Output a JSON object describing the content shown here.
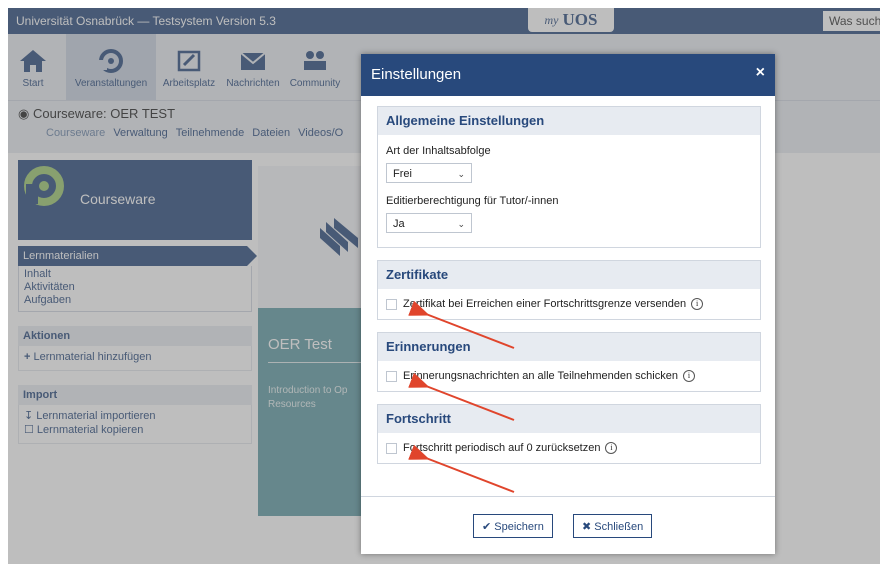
{
  "header": {
    "app_title": "Universität Osnabrück — Testsystem Version 5.3",
    "logo_prefix": "my",
    "logo_text": "UOS",
    "search_placeholder": "Was suche"
  },
  "nav": [
    {
      "label": "Start"
    },
    {
      "label": "Veranstaltungen"
    },
    {
      "label": "Arbeitsplatz"
    },
    {
      "label": "Nachrichten"
    },
    {
      "label": "Community"
    }
  ],
  "course": {
    "title": "Courseware: OER TEST",
    "tabs": [
      "Courseware",
      "Verwaltung",
      "Teilnehmende",
      "Dateien",
      "Videos/O"
    ]
  },
  "sidebar": {
    "courseware_label": "Courseware",
    "active_item": "Lernmaterialien",
    "items": [
      "Inhalt",
      "Aktivitäten",
      "Aufgaben"
    ],
    "actions_title": "Aktionen",
    "actions": [
      "Lernmaterial hinzufügen"
    ],
    "import_title": "Import",
    "imports": [
      "Lernmaterial importieren",
      "Lernmaterial kopieren"
    ]
  },
  "card": {
    "title": "OER Test",
    "desc_line1": "Introduction to Op",
    "desc_line2": "Resources"
  },
  "dialog": {
    "title": "Einstellungen",
    "close_icon": "×",
    "general": {
      "heading": "Allgemeine Einstellungen",
      "sequence_label": "Art der Inhaltsabfolge",
      "sequence_value": "Frei",
      "edit_label": "Editierberechtigung für Tutor/-innen",
      "edit_value": "Ja"
    },
    "certificates": {
      "heading": "Zertifikate",
      "checkbox_label": "Zertifikat bei Erreichen einer Fortschrittsgrenze versenden"
    },
    "reminders": {
      "heading": "Erinnerungen",
      "checkbox_label": "Erinnerungsnachrichten an alle Teilnehmenden schicken"
    },
    "progress": {
      "heading": "Fortschritt",
      "checkbox_label": "Fortschritt periodisch auf 0 zurücksetzen"
    },
    "save_label": "Speichern",
    "close_label": "Schließen"
  },
  "colors": {
    "brand": "#28497c",
    "card": "#5f9ca4",
    "annotation_arrow": "#e0452c"
  }
}
